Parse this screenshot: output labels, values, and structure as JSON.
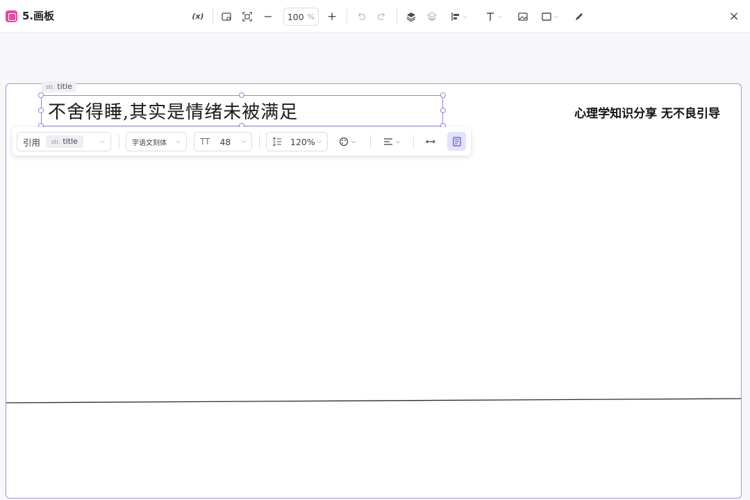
{
  "app": {
    "title": "5.画板"
  },
  "toolbar": {
    "variable_label": "(x)",
    "zoom_value": "100",
    "zoom_unit": "%",
    "minus": "−",
    "plus": "+",
    "close": "×"
  },
  "canvas": {
    "main_title": "不舍得睡,其实是情绪未被满足",
    "right_title": "心理学知识分享 无不良引导",
    "selection_tag_prefix": "str.",
    "selection_tag_label": "title"
  },
  "text_toolbar": {
    "reference_label": "引用",
    "reference_chip_prefix": "str.",
    "reference_chip_label": "title",
    "font_family_value": "字语文刻体",
    "font_size_value": "48",
    "line_height_value": "120%"
  },
  "colors": {
    "accent": "#8d84ea",
    "logo": "#e8489e",
    "active_bg": "#e3e1fb"
  }
}
